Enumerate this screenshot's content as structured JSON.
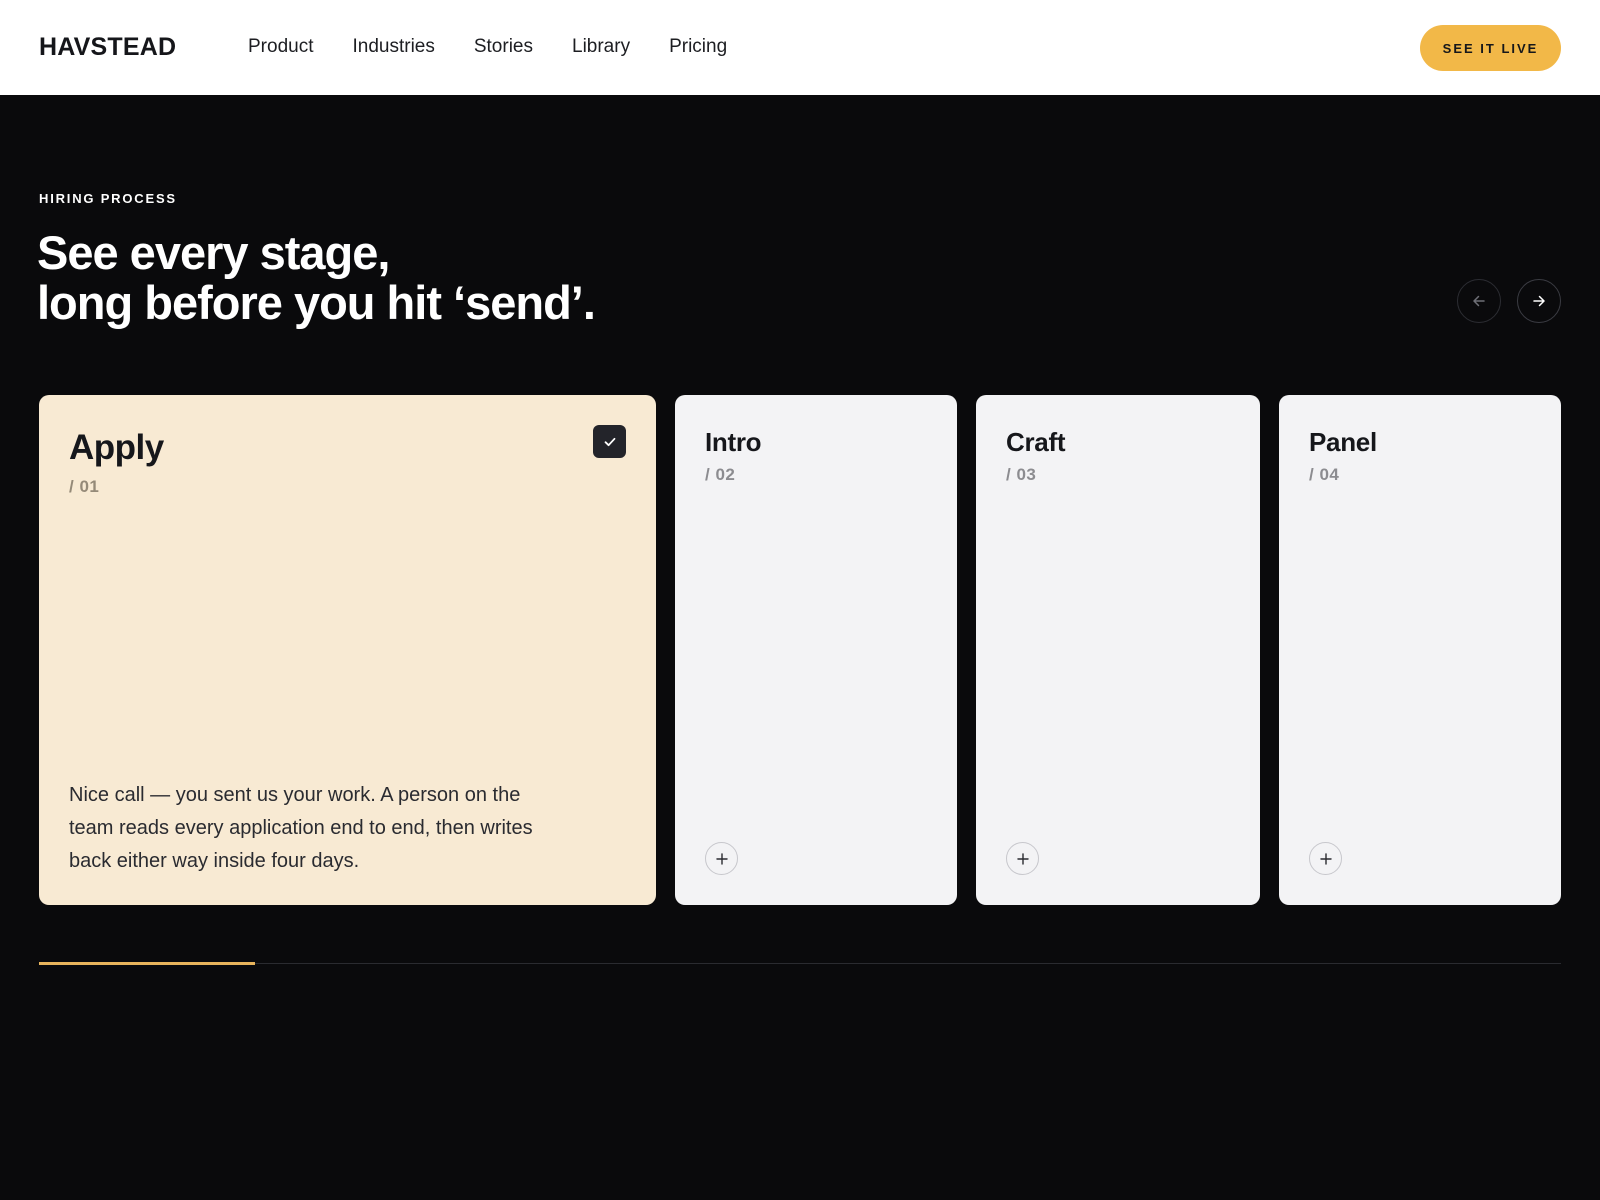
{
  "header": {
    "logo": "HAVSTEAD",
    "nav": [
      {
        "label": "Product"
      },
      {
        "label": "Industries"
      },
      {
        "label": "Stories"
      },
      {
        "label": "Library"
      },
      {
        "label": "Pricing"
      }
    ],
    "cta_label": "SEE IT LIVE"
  },
  "hero": {
    "eyebrow": "HIRING PROCESS",
    "headline_line1": "See every stage,",
    "headline_line2": "long before you hit ‘send’."
  },
  "controls": {
    "prev_icon": "arrow-left-icon",
    "next_icon": "arrow-right-icon"
  },
  "stages": [
    {
      "title": "Apply",
      "number": "/ 01",
      "active": true,
      "completed": true,
      "description": "Nice call — you sent us your work. A person on the team reads every application end to end, then writes back either way inside four days."
    },
    {
      "title": "Intro",
      "number": "/ 02",
      "active": false
    },
    {
      "title": "Craft",
      "number": "/ 03",
      "active": false
    },
    {
      "title": "Panel",
      "number": "/ 04",
      "active": false
    }
  ],
  "progress": {
    "fraction": 0.142
  },
  "colors": {
    "background": "#0a0a0c",
    "accent": "#f2b848",
    "active_card": "#f8ead3",
    "inactive_card": "#f3f3f5",
    "progress": "#e8b45c"
  }
}
